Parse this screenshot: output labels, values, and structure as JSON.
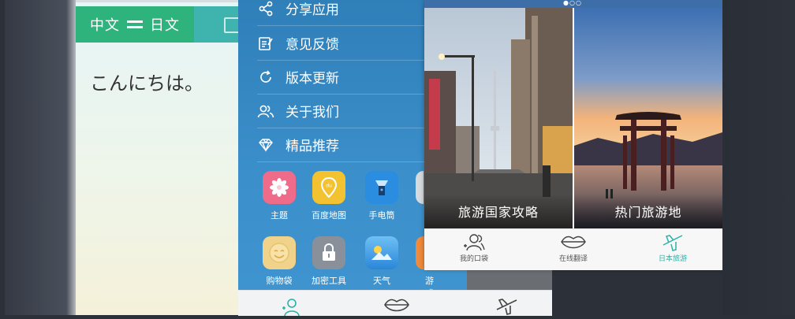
{
  "translator": {
    "source_lang": "中文",
    "target_lang": "日文",
    "input_text": "こんにちは。"
  },
  "menu": {
    "items": [
      {
        "label": "分享应用",
        "icon": "share-icon"
      },
      {
        "label": "意见反馈",
        "icon": "feedback-icon"
      },
      {
        "label": "版本更新",
        "icon": "refresh-icon"
      },
      {
        "label": "关于我们",
        "icon": "people-icon"
      },
      {
        "label": "精品推荐",
        "icon": "diamond-icon"
      }
    ],
    "apps": [
      {
        "label": "主题",
        "color": "#ef6b8a"
      },
      {
        "label": "百度地图",
        "color": "#f2c230"
      },
      {
        "label": "手电筒",
        "color": "#2a8de0"
      },
      {
        "label": "购物袋",
        "color": "#f0d28a"
      },
      {
        "label": "加密工具",
        "color": "#8a9099"
      },
      {
        "label": "天气",
        "color": "#3b9be6"
      },
      {
        "label": "游戏",
        "color": "#f08a3c"
      }
    ]
  },
  "travel": {
    "tiles": [
      {
        "label": "旅游国家攻略"
      },
      {
        "label": "热门旅游地"
      }
    ],
    "tabs": [
      {
        "label": "我的口袋",
        "icon": "pocket-people-icon"
      },
      {
        "label": "在线翻译",
        "icon": "lips-icon"
      },
      {
        "label": "日本旅游",
        "icon": "airplane-icon"
      }
    ],
    "active_tab_color": "#27b3a8"
  }
}
